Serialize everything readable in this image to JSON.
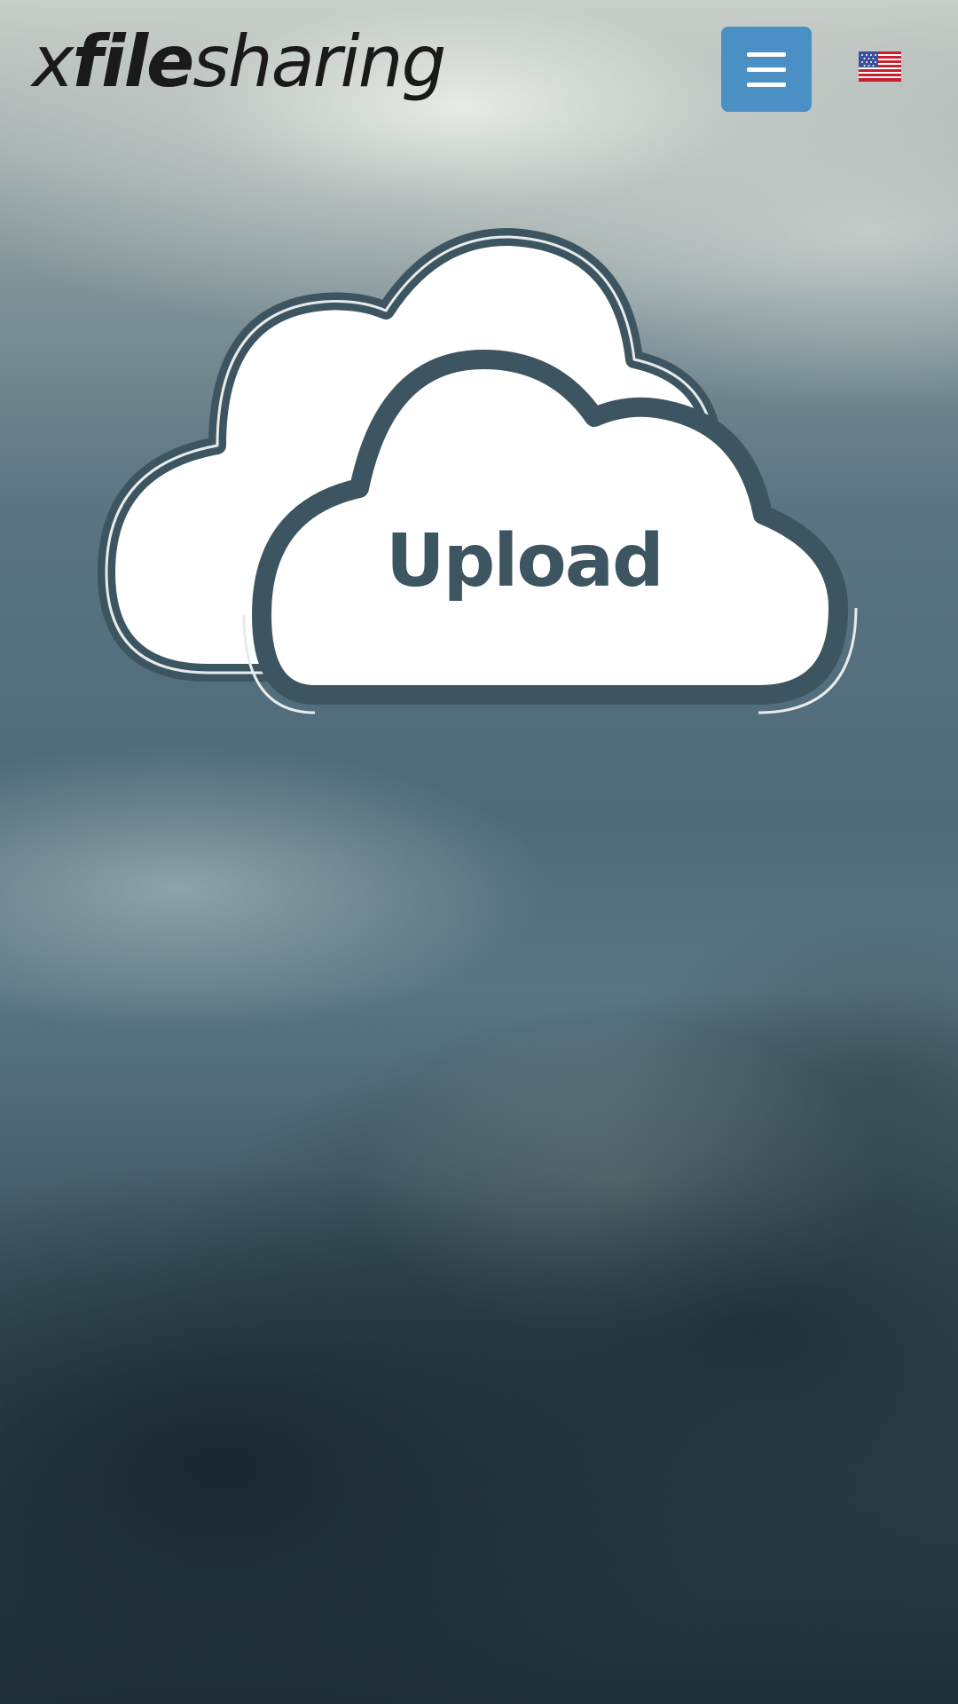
{
  "header": {
    "logo": {
      "x": "x",
      "file": "file",
      "sharing": "sharing"
    },
    "menu_icon": "hamburger-menu-icon",
    "language_icon": "us-flag-icon"
  },
  "main": {
    "upload_label": "Upload"
  },
  "colors": {
    "menu_button": "#4a90c4",
    "cloud_outline": "#3d5561",
    "cloud_fill": "#ffffff"
  }
}
